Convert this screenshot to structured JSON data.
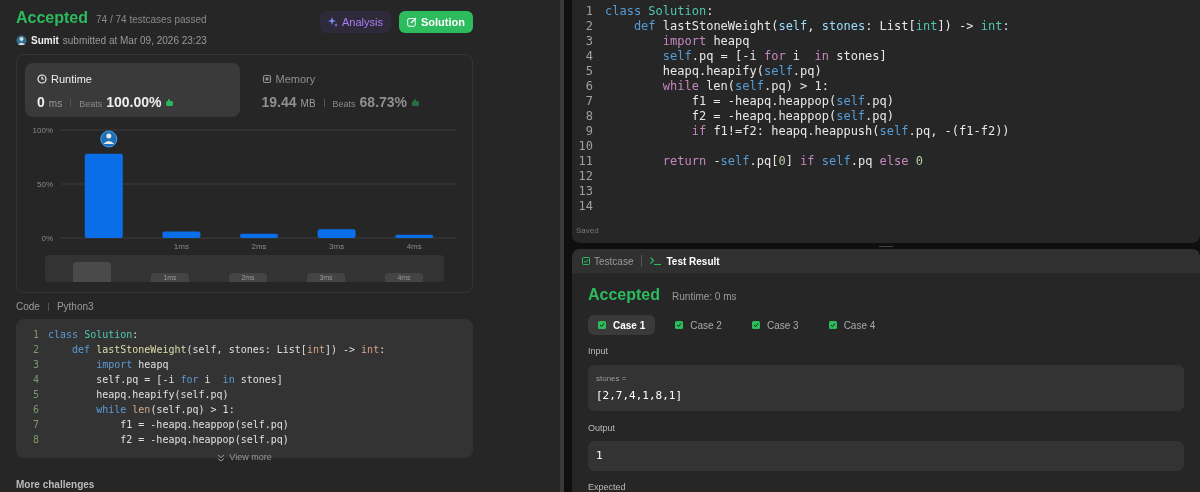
{
  "submission": {
    "status": "Accepted",
    "testcases": "74 / 74 testcases passed",
    "user": "Sumit",
    "submitted": "submitted at Mar 09, 2026 23:23",
    "buttons": [
      {
        "label": "Analysis",
        "kind": "analysis"
      },
      {
        "label": "Solution",
        "kind": "solution"
      }
    ]
  },
  "stats": [
    {
      "kind": "runtime",
      "title": "Runtime",
      "value": "0",
      "unit": "ms",
      "beats_label": "Beats",
      "beats": "100.00%",
      "selected": true
    },
    {
      "kind": "memory",
      "title": "Memory",
      "value": "19.44",
      "unit": "MB",
      "beats_label": "Beats",
      "beats": "68.73%",
      "selected": false
    }
  ],
  "chart_data": {
    "type": "bar",
    "x": [
      0,
      1,
      2,
      3,
      4
    ],
    "xlim": [
      -0.5,
      4.5
    ],
    "xticks": [
      {
        "value": 1,
        "label": "1ms"
      },
      {
        "value": 2,
        "label": "2ms"
      },
      {
        "value": 3,
        "label": "3ms"
      },
      {
        "value": 4,
        "label": "4ms"
      }
    ],
    "ylim": [
      0,
      100
    ],
    "yticks": [
      {
        "value": 0,
        "label": "0%"
      },
      {
        "value": 50,
        "label": "50%"
      },
      {
        "value": 100,
        "label": "100%"
      }
    ],
    "series": [
      {
        "color": "#0a6ee8",
        "values": [
          78,
          6,
          4,
          8,
          3
        ]
      }
    ]
  },
  "overview": {
    "labels": [
      "1ms",
      "2ms",
      "3ms",
      "4ms"
    ]
  },
  "code_section": {
    "label": "Code",
    "language": "Python3",
    "view_more": "View more",
    "lines": [
      {
        "number": "1",
        "tokens": [
          {
            "text": "class",
            "kind": "kw"
          },
          {
            "text": " Solution",
            "kind": "cls"
          },
          {
            "text": ":",
            "kind": "p"
          }
        ]
      },
      {
        "number": "2",
        "tokens": [
          {
            "text": "    def",
            "kind": "kw"
          },
          {
            "text": " lastStoneWeight",
            "kind": "fn"
          },
          {
            "text": "(self, stones: List[",
            "kind": "p"
          },
          {
            "text": "int",
            "kind": "type"
          },
          {
            "text": "]) -> ",
            "kind": "p"
          },
          {
            "text": "int",
            "kind": "type"
          },
          {
            "text": ":",
            "kind": "p"
          }
        ]
      },
      {
        "number": "3",
        "tokens": [
          {
            "text": "        import",
            "kind": "kw"
          },
          {
            "text": " heapq",
            "kind": "p"
          }
        ]
      },
      {
        "number": "4",
        "tokens": [
          {
            "text": "        self.pq = [-i ",
            "kind": "p"
          },
          {
            "text": "for",
            "kind": "kw"
          },
          {
            "text": " i  ",
            "kind": "p"
          },
          {
            "text": "in",
            "kind": "kw"
          },
          {
            "text": " stones]",
            "kind": "p"
          }
        ]
      },
      {
        "number": "5",
        "tokens": [
          {
            "text": "        heapq.heapify(self.pq)",
            "kind": "p"
          }
        ]
      },
      {
        "number": "6",
        "tokens": [
          {
            "text": "        while",
            "kind": "kw"
          },
          {
            "text": " len",
            "kind": "type"
          },
          {
            "text": "(self.pq) > 1:",
            "kind": "p"
          }
        ]
      },
      {
        "number": "7",
        "tokens": [
          {
            "text": "            f1 = -heapq.heappop(self.pq)",
            "kind": "p"
          }
        ]
      },
      {
        "number": "8",
        "tokens": [
          {
            "text": "            f2 = -heapq.heappop(self.pq)",
            "kind": "p"
          }
        ]
      }
    ]
  },
  "more_challenges": "More challenges",
  "editor": {
    "status": "Saved",
    "lines": [
      {
        "number": "1",
        "tokens": [
          {
            "text": "class",
            "kind": "kw"
          },
          {
            "text": " Solution",
            "kind": "cls"
          },
          {
            "text": ":",
            "kind": "p"
          }
        ]
      },
      {
        "number": "2",
        "tokens": [
          {
            "text": "    def",
            "kind": "kw"
          },
          {
            "text": " lastStoneWeight",
            "kind": "fn"
          },
          {
            "text": "(",
            "kind": "p"
          },
          {
            "text": "self",
            "kind": "param"
          },
          {
            "text": ", ",
            "kind": "p"
          },
          {
            "text": "stones",
            "kind": "param"
          },
          {
            "text": ": List[",
            "kind": "p"
          },
          {
            "text": "int",
            "kind": "type"
          },
          {
            "text": "]) -> ",
            "kind": "p"
          },
          {
            "text": "int",
            "kind": "type"
          },
          {
            "text": ":",
            "kind": "p"
          }
        ]
      },
      {
        "number": "3",
        "tokens": [
          {
            "text": "        import",
            "kind": "kw2"
          },
          {
            "text": " heapq",
            "kind": "p"
          }
        ]
      },
      {
        "number": "4",
        "tokens": [
          {
            "text": "        self",
            "kind": "self"
          },
          {
            "text": ".pq = [-i ",
            "kind": "p"
          },
          {
            "text": "for",
            "kind": "kw2"
          },
          {
            "text": " i  ",
            "kind": "p"
          },
          {
            "text": "in",
            "kind": "kw2"
          },
          {
            "text": " stones]",
            "kind": "p"
          }
        ]
      },
      {
        "number": "5",
        "tokens": [
          {
            "text": "        heapq.heapify(",
            "kind": "p"
          },
          {
            "text": "self",
            "kind": "self"
          },
          {
            "text": ".pq)",
            "kind": "p"
          }
        ]
      },
      {
        "number": "6",
        "tokens": [
          {
            "text": "        while",
            "kind": "kw2"
          },
          {
            "text": " len(",
            "kind": "p"
          },
          {
            "text": "self",
            "kind": "self"
          },
          {
            "text": ".pq) > 1:",
            "kind": "p"
          }
        ]
      },
      {
        "number": "7",
        "tokens": [
          {
            "text": "            f1 = -heapq.heappop(",
            "kind": "p"
          },
          {
            "text": "self",
            "kind": "self"
          },
          {
            "text": ".pq)",
            "kind": "p"
          }
        ]
      },
      {
        "number": "8",
        "tokens": [
          {
            "text": "            f2 = -heapq.heappop(",
            "kind": "p"
          },
          {
            "text": "self",
            "kind": "self"
          },
          {
            "text": ".pq)",
            "kind": "p"
          }
        ]
      },
      {
        "number": "9",
        "tokens": [
          {
            "text": "            if",
            "kind": "kw2"
          },
          {
            "text": " f1!=f2: heapq.heappush(",
            "kind": "p"
          },
          {
            "text": "self",
            "kind": "self"
          },
          {
            "text": ".pq, -(f1-f2))",
            "kind": "p"
          }
        ]
      },
      {
        "number": "10"
      },
      {
        "number": "11",
        "tokens": [
          {
            "text": "        return",
            "kind": "kw2"
          },
          {
            "text": " -",
            "kind": "p"
          },
          {
            "text": "self",
            "kind": "self"
          },
          {
            "text": ".pq[",
            "kind": "p"
          },
          {
            "text": "0",
            "kind": "num"
          },
          {
            "text": "] ",
            "kind": "p"
          },
          {
            "text": "if",
            "kind": "kw2"
          },
          {
            "text": " self",
            "kind": "self"
          },
          {
            "text": ".pq ",
            "kind": "p"
          },
          {
            "text": "else",
            "kind": "kw2"
          },
          {
            "text": " 0",
            "kind": "num"
          }
        ]
      },
      {
        "number": "12"
      },
      {
        "number": "13"
      },
      {
        "number": "14"
      }
    ]
  },
  "result_panel": {
    "tabs": [
      {
        "label": "Testcase",
        "kind": "testcase",
        "selected": false
      },
      {
        "label": "Test Result",
        "kind": "result",
        "selected": true
      }
    ],
    "status": "Accepted",
    "runtime": "Runtime: 0 ms",
    "cases": [
      {
        "label": "Case 1",
        "selected": true
      },
      {
        "label": "Case 2",
        "selected": false
      },
      {
        "label": "Case 3",
        "selected": false
      },
      {
        "label": "Case 4",
        "selected": false
      }
    ],
    "input_label": "Input",
    "input_var": "stones =",
    "input_value": "[2,7,4,1,8,1]",
    "output_label": "Output",
    "output_value": "1",
    "expected_label": "Expected"
  }
}
